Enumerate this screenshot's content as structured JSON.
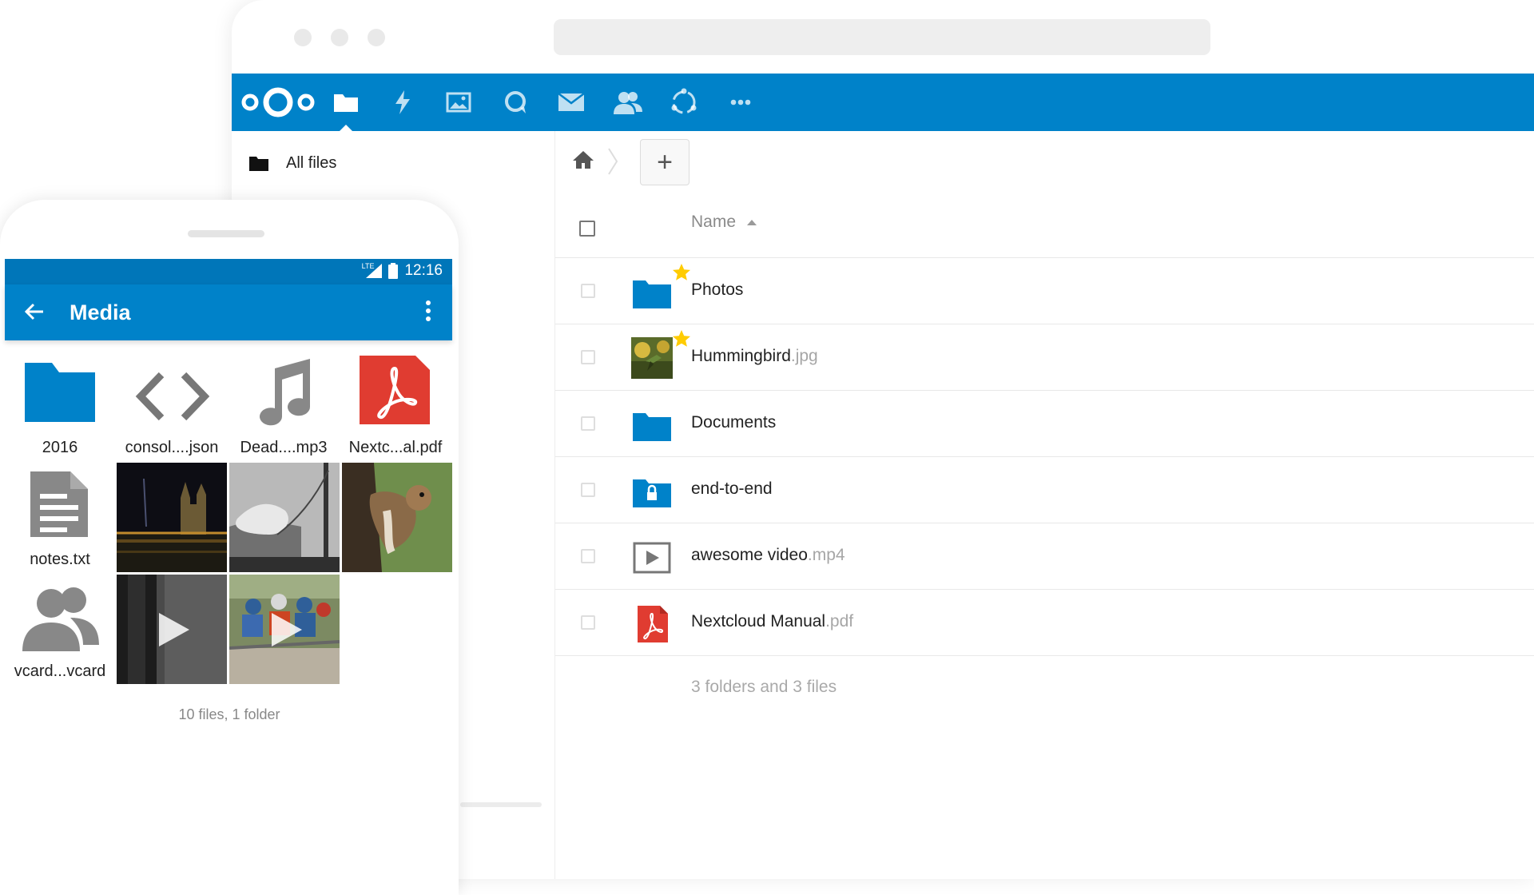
{
  "browser": {
    "nav_label": "All files"
  },
  "header_icons": [
    "nextcloud-logo",
    "files-icon",
    "activity-icon",
    "gallery-icon",
    "talk-icon",
    "mail-icon",
    "contacts-icon",
    "circles-icon",
    "more-icon"
  ],
  "file_list": {
    "column_name": "Name",
    "rows": [
      {
        "name": "Photos",
        "ext": "",
        "type": "folder",
        "starred": true
      },
      {
        "name": "Hummingbird",
        "ext": ".jpg",
        "type": "image",
        "starred": true
      },
      {
        "name": "Documents",
        "ext": "",
        "type": "folder",
        "starred": false
      },
      {
        "name": "end-to-end",
        "ext": "",
        "type": "encrypted-folder",
        "starred": false
      },
      {
        "name": "awesome video",
        "ext": ".mp4",
        "type": "video",
        "starred": false
      },
      {
        "name": "Nextcloud Manual",
        "ext": ".pdf",
        "type": "pdf",
        "starred": false
      }
    ],
    "summary": "3 folders and 3 files"
  },
  "phone": {
    "time": "12:16",
    "network": "LTE",
    "title": "Media",
    "tiles": [
      {
        "label": "2016",
        "type": "folder"
      },
      {
        "label": "consol....json",
        "type": "code"
      },
      {
        "label": "Dead....mp3",
        "type": "audio"
      },
      {
        "label": "Nextc...al.pdf",
        "type": "pdf"
      },
      {
        "label": "notes.txt",
        "type": "text"
      },
      {
        "label": "vcard...vcard",
        "type": "contact"
      }
    ],
    "summary": "10 files, 1 folder"
  },
  "colors": {
    "brand_blue": "#0082c9",
    "star_yellow": "#fc0",
    "pdf_red": "#e03c31"
  }
}
